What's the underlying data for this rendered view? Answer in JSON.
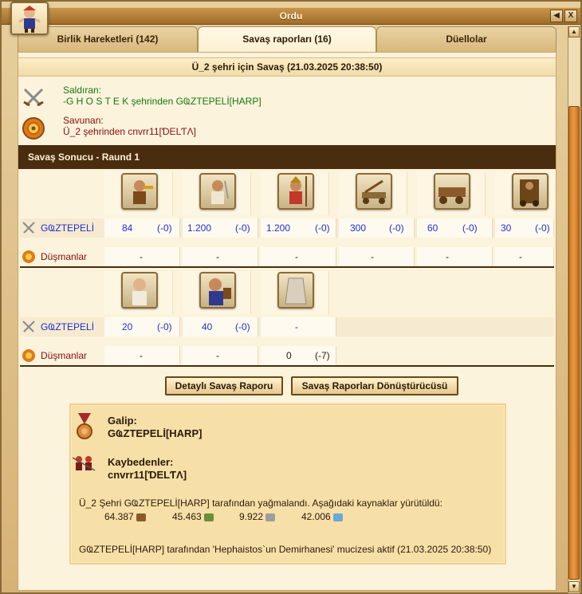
{
  "window": {
    "title": "Ordu",
    "help_icon": "left-arrow-icon",
    "close_label": "X"
  },
  "tabs": [
    {
      "label": "Birlik Hareketleri (142)",
      "active": false
    },
    {
      "label": "Savaş raporları (16)",
      "active": true
    },
    {
      "label": "Düellolar",
      "active": false
    }
  ],
  "report": {
    "title": "Ü_2 şehri için Savaş (21.03.2025 20:38:50)",
    "attacker": {
      "role": "Saldıran:",
      "line": "-G H O S T E K şehrinden GҨZTEPELİ[HARP]"
    },
    "defender": {
      "role": "Savunan:",
      "line": "Ü_2 şehrinden cnvrr11[ƊΕLƬΛ]"
    },
    "round_title": "Savaş Sonucu - Raund 1"
  },
  "round1": {
    "own_label": "GҨZTEPELİ",
    "enemy_label": "Düşmanlar",
    "own": [
      {
        "count": "84",
        "loss": "(-0)"
      },
      {
        "count": "1.200",
        "loss": "(-0)"
      },
      {
        "count": "1.200",
        "loss": "(-0)"
      },
      {
        "count": "300",
        "loss": "(-0)"
      },
      {
        "count": "60",
        "loss": "(-0)"
      },
      {
        "count": "30",
        "loss": "(-0)"
      }
    ],
    "enemy": [
      "-",
      "-",
      "-",
      "-",
      "-",
      "-"
    ]
  },
  "round2": {
    "own_label": "GҨZTEPELİ",
    "enemy_label": "Düşmanlar",
    "own": [
      {
        "count": "20",
        "loss": "(-0)"
      },
      {
        "count": "40",
        "loss": "(-0)"
      },
      {
        "count": "-",
        "loss": ""
      }
    ],
    "enemy": [
      {
        "count": "-",
        "loss": ""
      },
      {
        "count": "-",
        "loss": ""
      },
      {
        "count": "0",
        "loss": "(-7)"
      }
    ]
  },
  "buttons": {
    "detailed": "Detaylı Savaş Raporu",
    "converter": "Savaş Raporları Dönüştürücüsü"
  },
  "summary": {
    "winner_label": "Galip:",
    "winner": "GҨZTEPELİ[HARP]",
    "loser_label": "Kaybedenler:",
    "loser": "cnvrr11[ƊΕLƬΛ]",
    "plunder_text": "Ü_2 Şehri GҨZTEPELİ[HARP] tarafından yağmalandı. Aşağıdaki kaynaklar yürütüldü:",
    "resources": [
      {
        "value": "64.387",
        "icon": "wood-icon"
      },
      {
        "value": "45.463",
        "icon": "stone-icon"
      },
      {
        "value": "9.922",
        "icon": "silver-icon"
      },
      {
        "value": "42.006",
        "icon": "ore-icon"
      }
    ],
    "miracle_text": "GҨZTEPELİ[HARP] tarafından 'Hephaistos`un Demirhanesi' mucizesi aktif (21.03.2025 20:38:50)"
  }
}
